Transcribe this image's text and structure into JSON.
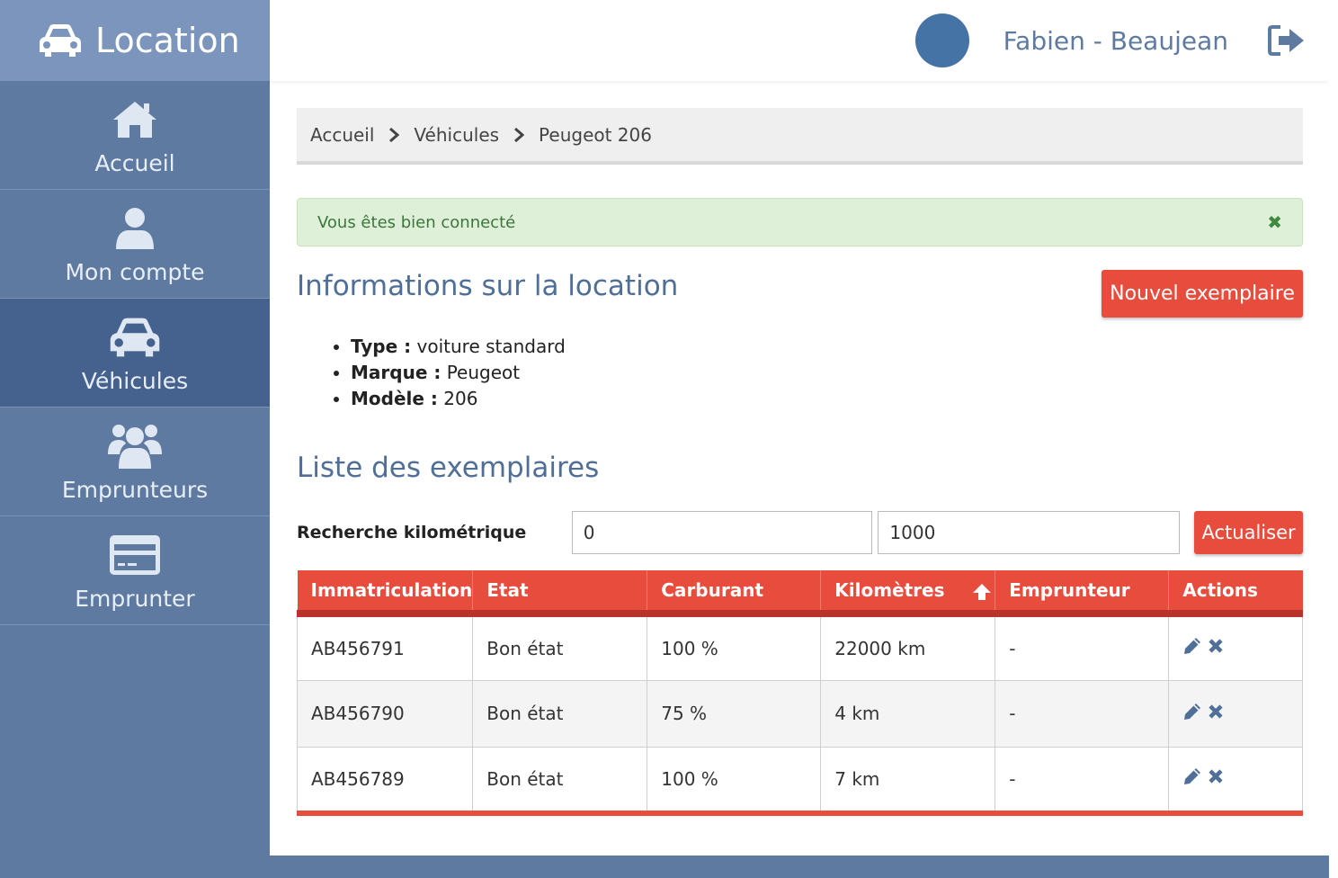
{
  "brand": {
    "title": "Location",
    "icon": "car-icon"
  },
  "sidebar": {
    "items": [
      {
        "label": "Accueil",
        "icon": "home-icon"
      },
      {
        "label": "Mon compte",
        "icon": "user-icon"
      },
      {
        "label": "Véhicules",
        "icon": "car-icon",
        "active": true
      },
      {
        "label": "Emprunteurs",
        "icon": "users-icon"
      },
      {
        "label": "Emprunter",
        "icon": "credit-card-icon"
      }
    ]
  },
  "header": {
    "username": "Fabien - Beaujean",
    "logout_icon": "sign-out-icon"
  },
  "breadcrumb": [
    "Accueil",
    "Véhicules",
    "Peugeot 206"
  ],
  "alert": {
    "message": "Vous êtes bien connecté",
    "close": "✖"
  },
  "info": {
    "title": "Informations sur la location",
    "new_button": "Nouvel exemplaire",
    "items": [
      {
        "label": "Type :",
        "value": " voiture standard"
      },
      {
        "label": "Marque :",
        "value": " Peugeot"
      },
      {
        "label": "Modèle :",
        "value": " 206"
      }
    ]
  },
  "list": {
    "title": "Liste des exemplaires",
    "search_label": "Recherche kilométrique",
    "min_value": "0",
    "max_value": "1000",
    "refresh_button": "Actualiser",
    "columns": [
      "Immatriculation",
      "Etat",
      "Carburant",
      "Kilomètres",
      "Emprunteur",
      "Actions"
    ],
    "sorted_column": "Kilomètres",
    "rows": [
      [
        "AB456791",
        "Bon état",
        "100 %",
        "22000 km",
        "-"
      ],
      [
        "AB456790",
        "Bon état",
        "75 %",
        "4 km",
        "-"
      ],
      [
        "AB456789",
        "Bon état",
        "100 %",
        "7 km",
        "-"
      ]
    ]
  },
  "colors": {
    "accent_red": "#e84c3d",
    "sidebar": "#5f7aa0",
    "active_nav": "#45628f",
    "heading": "#4f6f98"
  }
}
